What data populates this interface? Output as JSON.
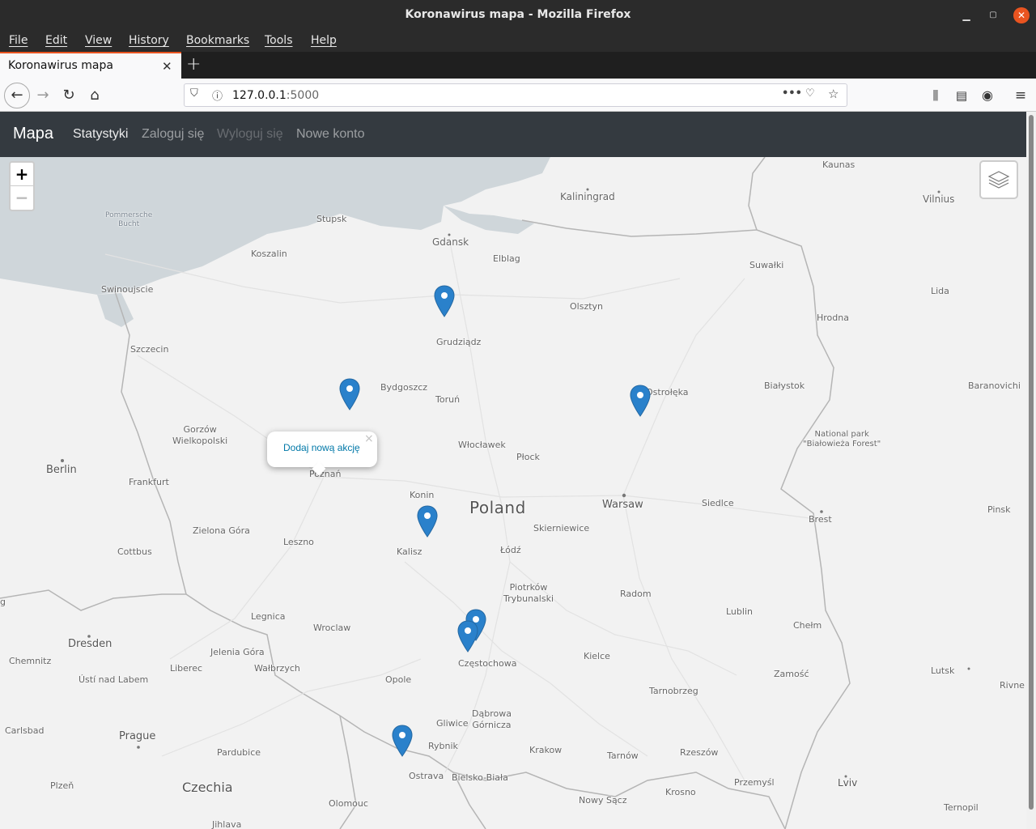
{
  "window": {
    "title": "Koronawirus mapa - Mozilla Firefox"
  },
  "menu": {
    "file": "File",
    "edit": "Edit",
    "view": "View",
    "history": "History",
    "bookmarks": "Bookmarks",
    "tools": "Tools",
    "help": "Help"
  },
  "tab": {
    "title": "Koronawirus mapa",
    "close": "✕",
    "new": "+"
  },
  "url": {
    "host": "127.0.0.1",
    "port": ":5000"
  },
  "app": {
    "brand": "Mapa",
    "links": {
      "stats": "Statystyki",
      "login": "Zaloguj się",
      "logout": "Wyloguj się",
      "register": "Nowe konto"
    }
  },
  "map": {
    "zoom_in": "+",
    "zoom_out": "−",
    "popup": {
      "text": "Dodaj nową akcję",
      "close": "×"
    },
    "labels": {
      "pommersche": "Pommersche\nBucht",
      "kaliningrad": "Kaliningrad",
      "kaunas": "Kaunas",
      "vilnius": "Vilnius",
      "stupsk": "Stupsk",
      "gdansk": "Gdansk",
      "elblag": "Elblag",
      "koszalin": "Koszalin",
      "swinoujscie": "Swinoujscie",
      "olsztyn": "Olsztyn",
      "suwalki": "Suwałki",
      "lida": "Lida",
      "hrodna": "Hrodna",
      "grudziadz": "Grudziądz",
      "szczecin": "Szczecin",
      "bydgoszcz": "Bydgoszcz",
      "torun": "Toruń",
      "ostroleka": "Ostrołęka",
      "bialystok": "Białystok",
      "baranovichi": "Baranovichi",
      "gorzow": "Gorzów\nWielkopolski",
      "park": "National park\n\"Białowieża Forest\"",
      "wloclawek": "Włocławek",
      "berlin": "Berlin",
      "plock": "Płock",
      "frankfurt": "Frankfurt",
      "poznan": "Poznań",
      "konin": "Konin",
      "poland": "Poland",
      "warsaw": "Warsaw",
      "siedlce": "Siedlce",
      "brest": "Brest",
      "pinsk": "Pinsk",
      "zielona": "Zielona Góra",
      "skierniewice": "Skierniewice",
      "leszno": "Leszno",
      "kalisz": "Kalisz",
      "lodz": "Łódź",
      "cottbus": "Cottbus",
      "piotrkow": "Piotrków\nTrybunalski",
      "radom": "Radom",
      "lublin": "Lublin",
      "legnica": "Legnica",
      "wroclaw": "Wroclaw",
      "chelm": "Chełm",
      "dresden": "Dresden",
      "jelenia": "Jelenia Góra",
      "kielce": "Kielce",
      "chemnitz": "Chemnitz",
      "liberec": "Liberec",
      "walbrzych": "Wałbrzych",
      "czestochowa": "Częstochowa",
      "lutsk": "Lutsk",
      "zamosc": "Zamość",
      "usti": "Ústí nad Labem",
      "opole": "Opole",
      "rivne": "Rivne",
      "tarnobrzeg": "Tarnobrzeg",
      "dabrowa": "Dąbrowa\nGórnicza",
      "gliwice": "Gliwice",
      "carlsbad": "Carlsbad",
      "prague": "Prague",
      "rybnik": "Rybnik",
      "pardubice": "Pardubice",
      "krakow": "Krakow",
      "tarnow": "Tarnów",
      "rzeszow": "Rzeszów",
      "czechia": "Czechia",
      "ostrava": "Ostrava",
      "bielsko": "Bielsko-Biała",
      "przemysl": "Przemyśl",
      "lviv": "Lviv",
      "plzen": "Plzeň",
      "krosno": "Krosno",
      "olomouc": "Olomouc",
      "nowysacz": "Nowy Sącz",
      "ternopil": "Ternopil",
      "jihlava": "Jihlava",
      "g": "g"
    },
    "marker_color": "#2a81cb"
  }
}
